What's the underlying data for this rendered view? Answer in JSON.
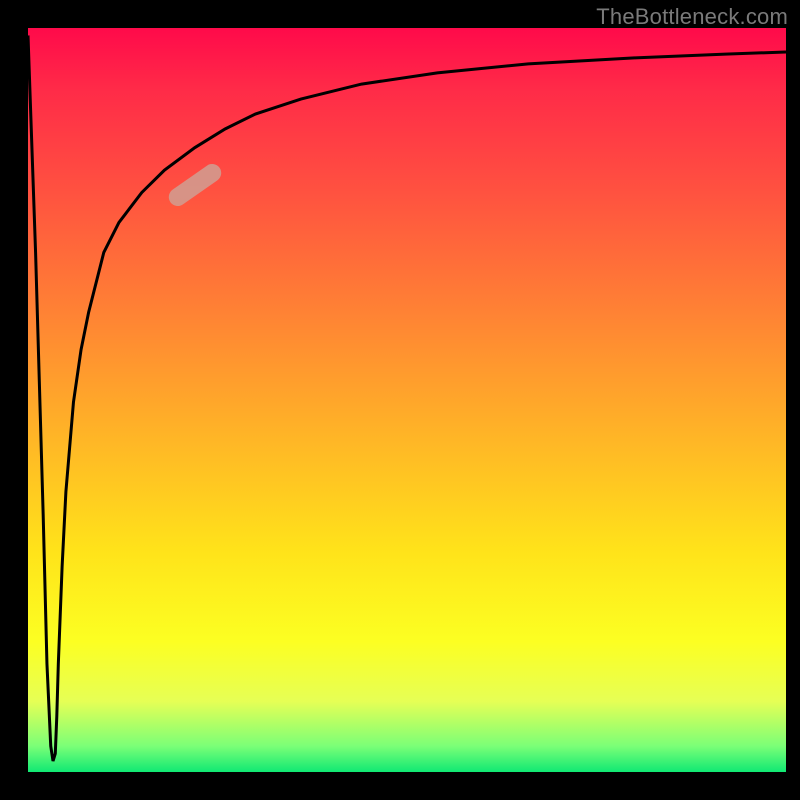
{
  "watermark": "TheBottleneck.com",
  "colors": {
    "curve_stroke": "#000000",
    "marker_fill": "#d29c90",
    "bg_black": "#000000"
  },
  "chart_data": {
    "type": "line",
    "title": "",
    "xlabel": "",
    "ylabel": "",
    "xlim": [
      0,
      100
    ],
    "ylim": [
      0,
      100
    ],
    "grid": false,
    "legend": false,
    "annotations": [
      {
        "kind": "capsule-marker",
        "x": 22,
        "y": 79,
        "angle_deg": 35
      }
    ],
    "series": [
      {
        "name": "bottleneck-curve",
        "x": [
          0,
          1,
          2,
          2.5,
          3,
          3.3,
          3.6,
          3.8,
          4,
          4.5,
          5,
          6,
          7,
          8,
          10,
          12,
          15,
          18,
          22,
          26,
          30,
          36,
          44,
          54,
          66,
          80,
          92,
          100
        ],
        "y": [
          99,
          70,
          35,
          15,
          4,
          2,
          3,
          8,
          15,
          28,
          38,
          50,
          57,
          62,
          70,
          74,
          78,
          81,
          84,
          86.5,
          88.5,
          90.5,
          92.5,
          94,
          95.2,
          96,
          96.5,
          96.8
        ]
      }
    ],
    "gradient_stops": [
      {
        "pos": 0.0,
        "color": "#ff0a4a"
      },
      {
        "pos": 0.08,
        "color": "#ff2a48"
      },
      {
        "pos": 0.22,
        "color": "#ff5240"
      },
      {
        "pos": 0.38,
        "color": "#ff8234"
      },
      {
        "pos": 0.54,
        "color": "#ffb327"
      },
      {
        "pos": 0.7,
        "color": "#ffe31a"
      },
      {
        "pos": 0.82,
        "color": "#fcff22"
      },
      {
        "pos": 0.9,
        "color": "#e6ff55"
      },
      {
        "pos": 0.96,
        "color": "#7bff77"
      },
      {
        "pos": 1.0,
        "color": "#00e573"
      }
    ]
  }
}
